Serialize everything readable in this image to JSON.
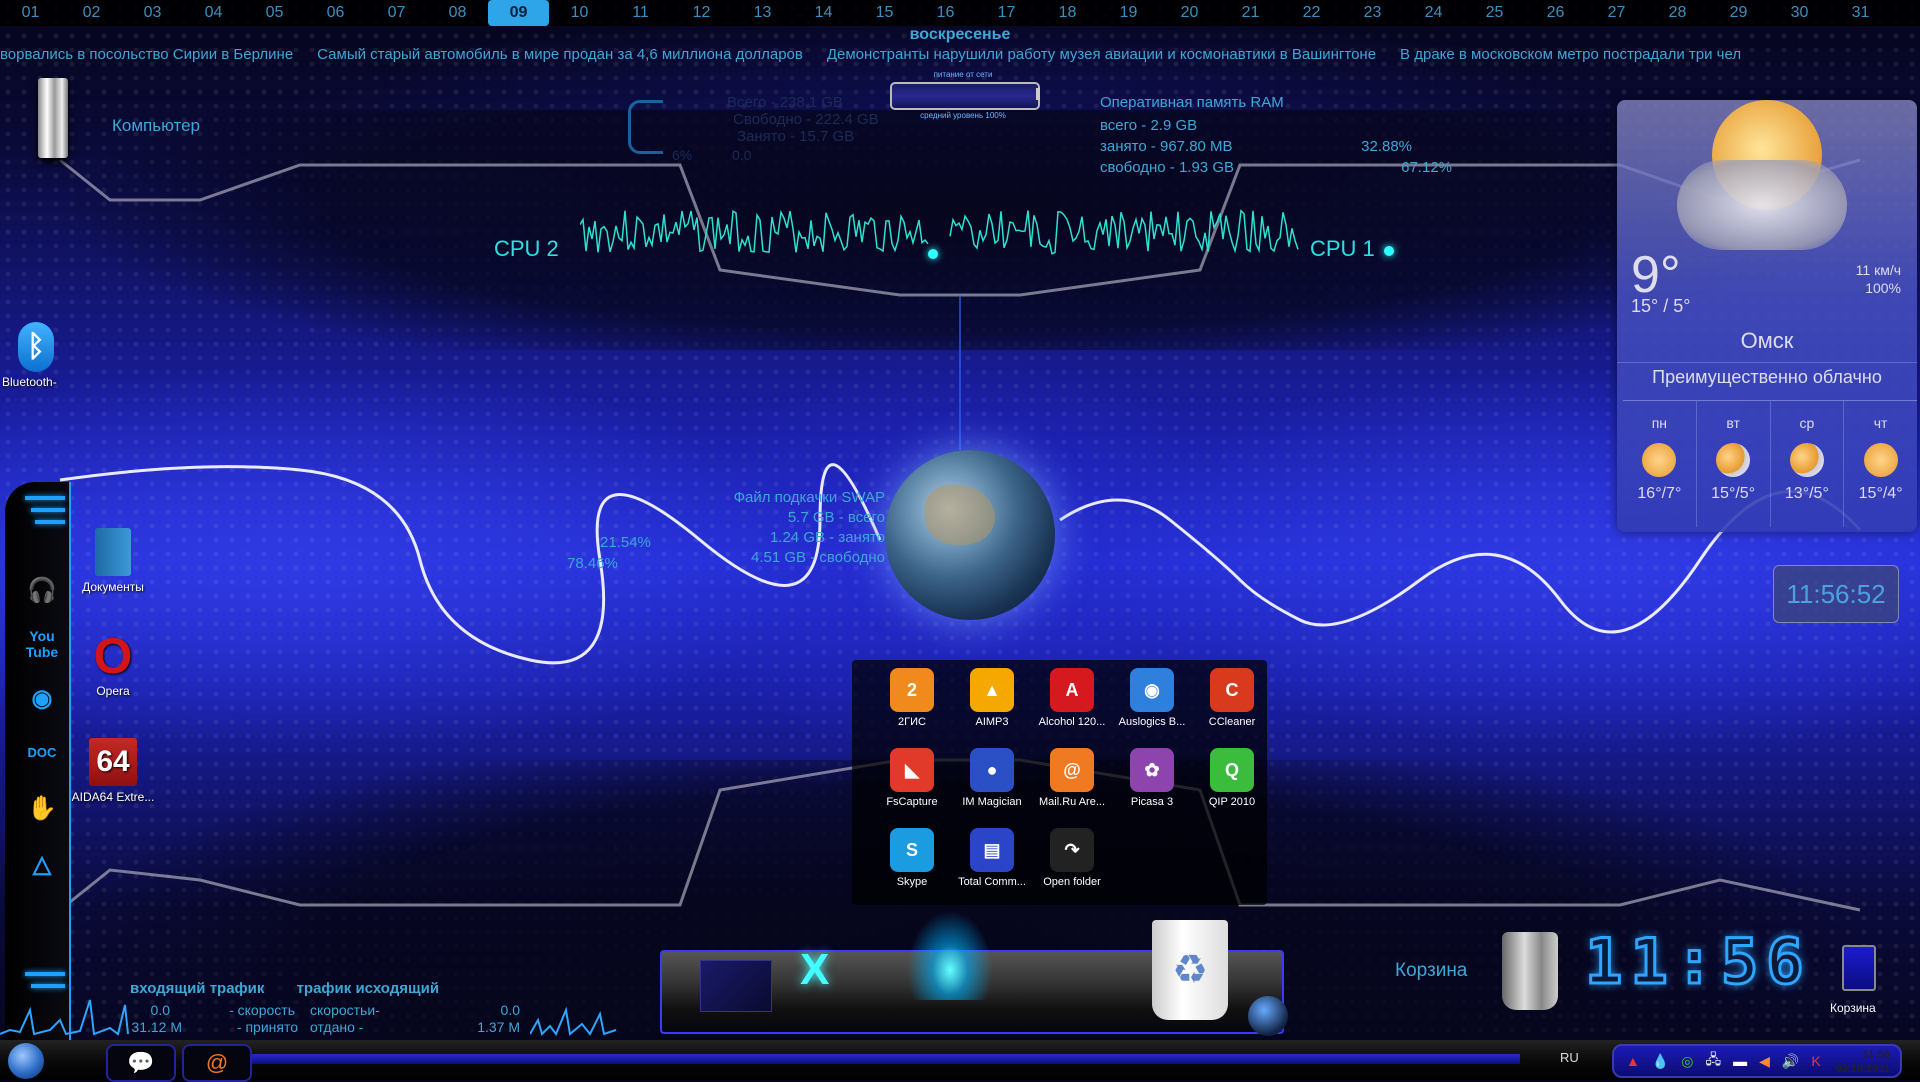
{
  "calendar": {
    "days": [
      "01",
      "02",
      "03",
      "04",
      "05",
      "06",
      "07",
      "08",
      "09",
      "10",
      "11",
      "12",
      "13",
      "14",
      "15",
      "16",
      "17",
      "18",
      "19",
      "20",
      "21",
      "22",
      "23",
      "24",
      "25",
      "26",
      "27",
      "28",
      "29",
      "30",
      "31"
    ],
    "active_day": "09",
    "weekday": "воскресенье"
  },
  "news_ticker": [
    "ворвались в посольство Сирии в Берлине",
    "Самый старый автомобиль в мире продан за 4,6 миллиона долларов",
    "Демонстранты нарушили работу музея авиации и космонавтики в Вашингтоне",
    "В драке в московском метро пострадали три чел"
  ],
  "desktop": {
    "computer_label": "Компьютер",
    "bluetooth_label": "Bluetooth-",
    "documents_label": "Документы",
    "opera_label": "Opera",
    "aida_label": "AIDA64 Extre...",
    "trash_label": "Корзина",
    "trash_icon_label": "Корзина"
  },
  "disk": {
    "total": "Всего - 238.1 GB",
    "free": "Свободно - 222.4 GB",
    "used": "Занято - 15.7 GB",
    "percent": "6%",
    "value": "0.0"
  },
  "battery": {
    "top_label": "питание от сети",
    "bottom_label": "средний уровень 100%",
    "level_percent": 100
  },
  "ram": {
    "title": "Оперативная память RAM",
    "total": "всего - 2.9 GB",
    "used": "занято - 967.80 MB",
    "used_pct": "32.88%",
    "free": "свободно - 1.93 GB",
    "free_pct": "67.12%"
  },
  "cpu": {
    "cpu2_label": "CPU 2",
    "cpu1_label": "CPU 1"
  },
  "swap": {
    "title": "Файл подкачки SWAP",
    "total": "5.7 GB - всего",
    "used": "1.24 GB - занято",
    "free": "4.51 GB - свободно",
    "pct_used": "21.54%",
    "pct_free": "78.46%"
  },
  "launcher": {
    "apps": [
      {
        "label": "2ГИС",
        "glyph": "2",
        "color": "#f08a1c"
      },
      {
        "label": "AIMP3",
        "glyph": "▲",
        "color": "#f5a800"
      },
      {
        "label": "Alcohol 120...",
        "glyph": "A",
        "color": "#d6181f"
      },
      {
        "label": "Auslogics B...",
        "glyph": "◉",
        "color": "#2f7fdc"
      },
      {
        "label": "CCleaner",
        "glyph": "C",
        "color": "#d93a1e"
      },
      {
        "label": "FsCapture",
        "glyph": "◣",
        "color": "#e23a2a"
      },
      {
        "label": "IM Magician",
        "glyph": "●",
        "color": "#2b4fc4"
      },
      {
        "label": "Mail.Ru Are...",
        "glyph": "@",
        "color": "#f07a22"
      },
      {
        "label": "Picasa 3",
        "glyph": "✿",
        "color": "#8e44ad"
      },
      {
        "label": "QIP 2010",
        "glyph": "Q",
        "color": "#3cbc3c"
      },
      {
        "label": "Skype",
        "glyph": "S",
        "color": "#1b9be0"
      },
      {
        "label": "Total Comm...",
        "glyph": "▤",
        "color": "#2a45c8"
      },
      {
        "label": "Open folder",
        "glyph": "↷",
        "color": "#222222"
      }
    ]
  },
  "weather": {
    "temp": "9°",
    "range": "15° / 5°",
    "wind": "11 км/ч",
    "humidity": "100%",
    "city": "Омск",
    "condition": "Преимущественно облачно",
    "forecast": [
      {
        "day": "пн",
        "temps": "16°/7°",
        "icon": "sunny"
      },
      {
        "day": "вт",
        "temps": "15°/5°",
        "icon": "partly-cloudy"
      },
      {
        "day": "ср",
        "temps": "13°/5°",
        "icon": "partly-cloudy"
      },
      {
        "day": "чт",
        "temps": "15°/4°",
        "icon": "sunny"
      }
    ]
  },
  "clocks": {
    "small": "11:56:52",
    "big": "11:56",
    "tray_time": "11:56",
    "tray_date": "09.10.2011"
  },
  "traffic": {
    "in_title": "входящий трафик",
    "out_title": "трафик исходящий",
    "in_speed": "0.0",
    "in_total": "31.12 M",
    "speed_label": "- скорость",
    "received_label": "- принято",
    "out_speed_label": "скоростьи-",
    "sent_label": "отдано -",
    "out_speed": "0.0",
    "out_total": "1.37 M"
  },
  "taskbar": {
    "lang": "RU",
    "tray_icons": [
      "alcohol-icon",
      "droplet-icon",
      "green-ring-icon",
      "network-icon",
      "flag-icon",
      "speaker-muted-icon",
      "volume-icon",
      "kaspersky-icon"
    ]
  }
}
